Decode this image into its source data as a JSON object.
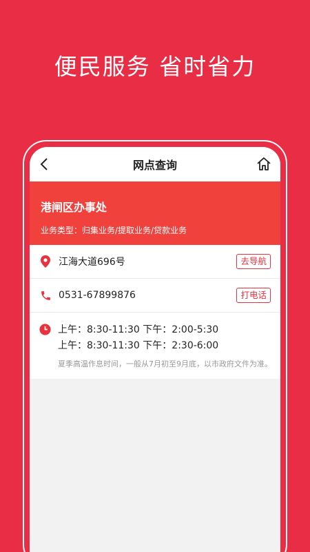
{
  "hero": {
    "slogan": "便民服务  省时省力"
  },
  "navbar": {
    "title": "网点查询",
    "back_icon": "chevron-left-icon",
    "home_icon": "home-icon"
  },
  "office": {
    "name": "港闸区办事处",
    "business": "业务类型：归集业务/提取业务/贷款业务"
  },
  "address": {
    "text": "江海大道696号",
    "action": "去导航",
    "icon": "location-pin-icon"
  },
  "phone": {
    "text": "0531-67899876",
    "action": "打电话",
    "icon": "phone-icon"
  },
  "hours": {
    "icon": "clock-icon",
    "line1": "上午：8:30-11:30  下午：2:00-5:30",
    "line2": "上午：8:30-11:30  下午：2:30-6:00",
    "note": "夏季高温作息时间，一般从7月初至9月底，以市政府文件为准。"
  },
  "colors": {
    "background": "#e82d45",
    "banner": "#f0413d",
    "accent": "#e8323d"
  }
}
